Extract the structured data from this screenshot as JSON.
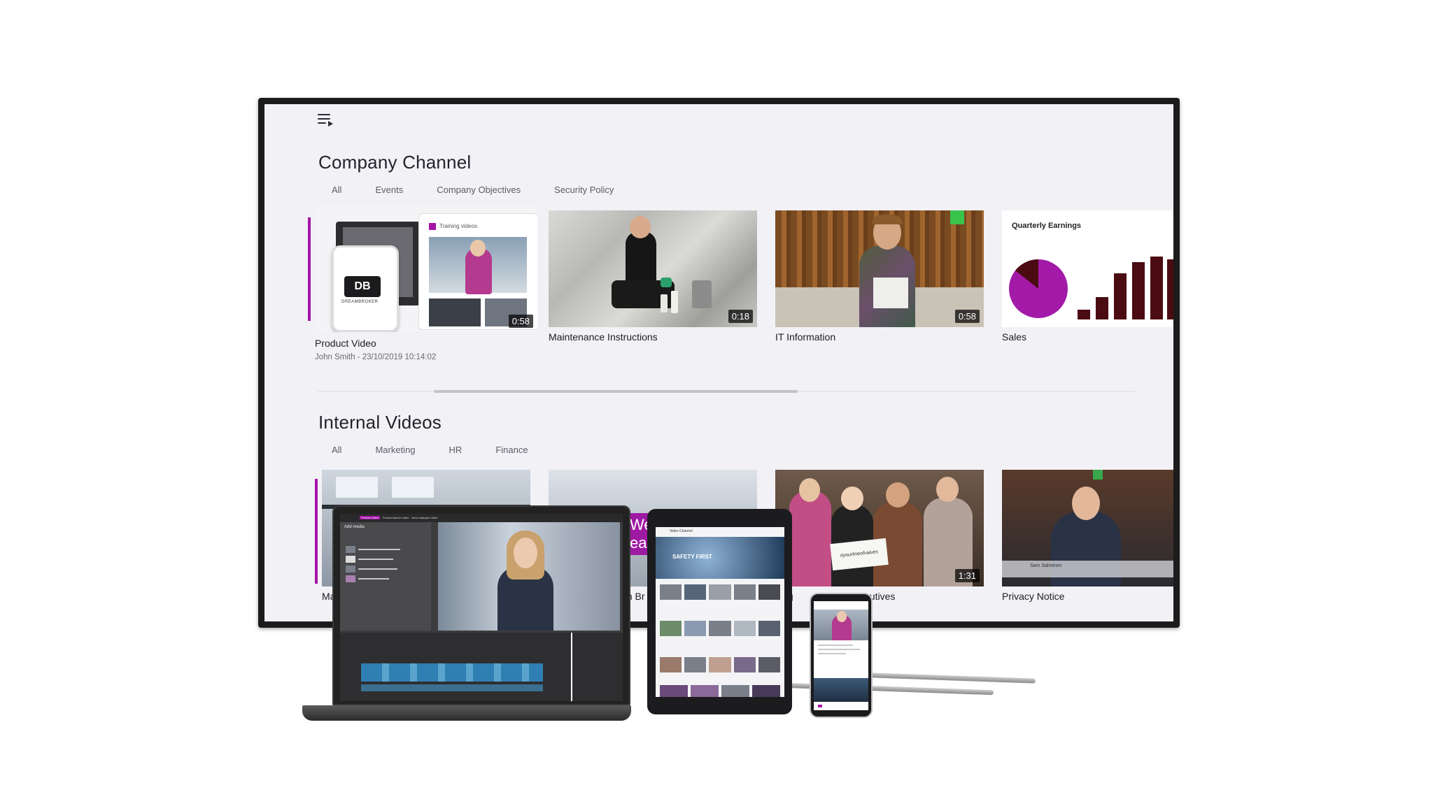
{
  "tv": {
    "menu_icon": "playlist-menu-icon",
    "sections": [
      {
        "title": "Company Channel",
        "tabs": [
          "All",
          "Events",
          "Company Objectives",
          "Security Policy"
        ],
        "cards": [
          {
            "title": "Product Video",
            "meta": "John Smith - 23/10/2019 10:14:02",
            "duration": "0:58",
            "inner_label": "Training videos",
            "logo_text": "DREAMBROKER"
          },
          {
            "title": "Maintenance Instructions",
            "duration": "0:18"
          },
          {
            "title": "IT Information",
            "duration": "0:58"
          },
          {
            "title": "Sales",
            "chart_title": "Quarterly Earnings"
          }
        ]
      },
      {
        "title": "Internal Videos",
        "tabs": [
          "All",
          "Marketing",
          "HR",
          "Finance"
        ],
        "cards": [
          {
            "title_partial": "Ma"
          },
          {
            "title_partial": "m Br",
            "overlay_text": "Welc",
            "overlay_text2": "ear"
          },
          {
            "title_partial_left": "king",
            "title_partial": "Executives",
            "duration": "1:31",
            "sign_text": "#yourlineofvalues"
          },
          {
            "title": "Privacy Notice",
            "lower_third": "Sam Salminen"
          }
        ]
      }
    ]
  },
  "laptop": {
    "panel_title": "Add media",
    "tabs": [
      "Product Video",
      "Product launch video",
      "New employee video"
    ]
  },
  "tablet": {
    "header": "Video Channel",
    "hero_text": "SAFETY FIRST"
  },
  "colors": {
    "accent": "#a514a8",
    "screen_bg": "#f2f1f5",
    "bar_dark": "#4a0b12",
    "pie_magenta": "#a31aa8"
  }
}
